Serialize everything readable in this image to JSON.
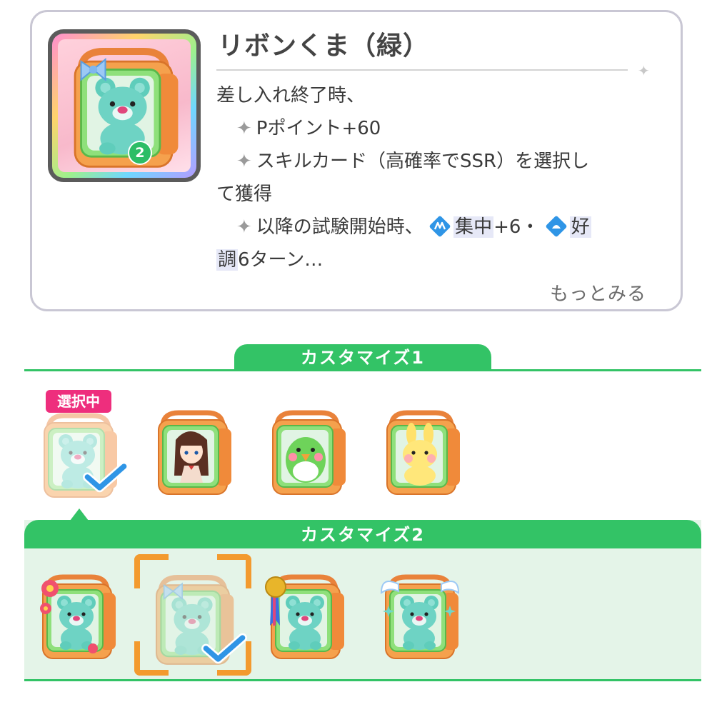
{
  "item": {
    "title": "リボンくま（緑）",
    "level": "2",
    "desc_line1": "差し入れ終了時、",
    "desc_line2": "Pポイント+60",
    "desc_line3a": "スキルカード（高確率でSSR）を選択し",
    "desc_line3b": "て獲得",
    "desc_line4_prefix": "以降の試験開始時、",
    "buff1": "集中",
    "buff1_value": "+6・",
    "buff2_start": "好",
    "buff2_end": "調",
    "desc_line5_suffix": "6ターン…",
    "more_label": "もっとみる",
    "star_glyph": "✦"
  },
  "customize1": {
    "label": "カスタマイズ1",
    "selected_tag": "選択中",
    "options": [
      {
        "name": "green-bear",
        "selected": true
      },
      {
        "name": "girl-doll",
        "selected": false
      },
      {
        "name": "green-bird",
        "selected": false
      },
      {
        "name": "yellow-bunny",
        "selected": false
      }
    ]
  },
  "customize2": {
    "label": "カスタマイズ2",
    "options": [
      {
        "name": "flower",
        "selected": false
      },
      {
        "name": "ribbon",
        "selected": true
      },
      {
        "name": "medal",
        "selected": false
      },
      {
        "name": "angel-wings",
        "selected": false
      }
    ]
  },
  "colors": {
    "green_accent": "#33c366",
    "pink_tag": "#ee2e7d",
    "orange_bracket": "#f39a2e",
    "check_blue": "#2f95e6"
  },
  "icons": [
    "concentration-buff-icon",
    "good-condition-buff-icon",
    "checkmark-icon",
    "sparkle-icon"
  ]
}
